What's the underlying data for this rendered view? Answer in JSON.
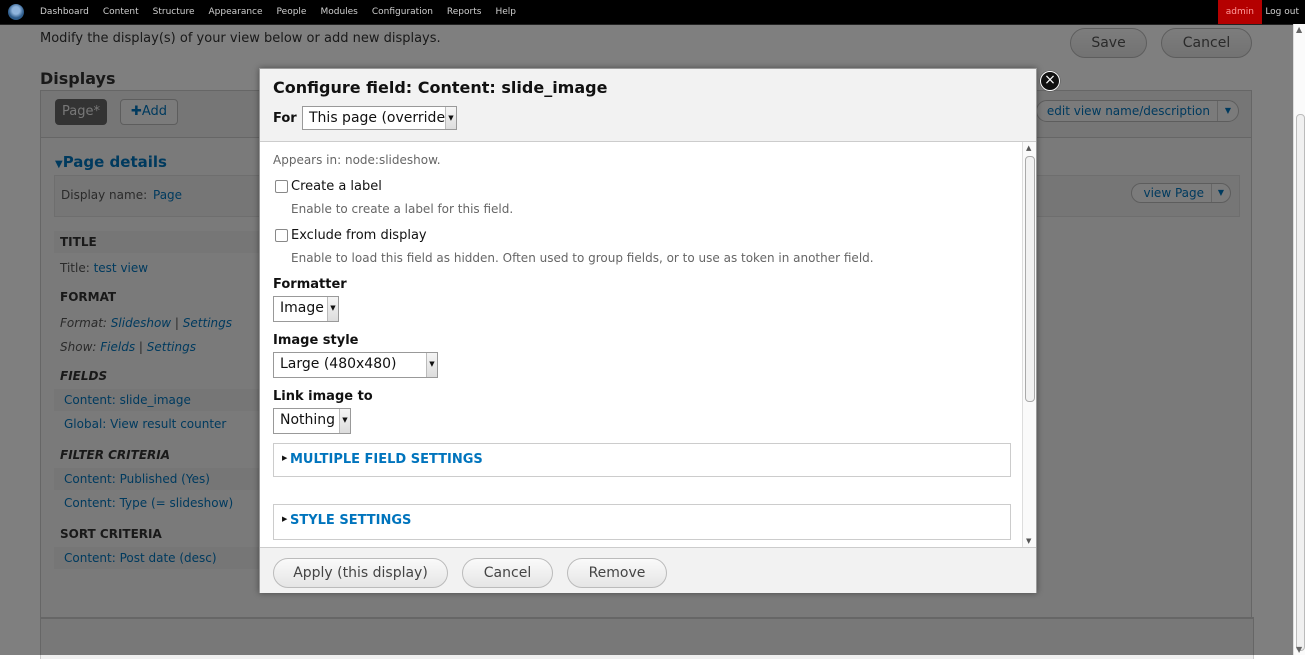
{
  "toolbar": {
    "menu": [
      "Dashboard",
      "Content",
      "Structure",
      "Appearance",
      "People",
      "Modules",
      "Configuration",
      "Reports",
      "Help"
    ],
    "user": "admin",
    "logout": "Log out"
  },
  "page": {
    "intro": "Modify the display(s) of your view below or add new displays.",
    "save": "Save",
    "cancel": "Cancel",
    "displays_heading": "Displays",
    "tab_page": "Page*",
    "tab_add": "Add",
    "edit_view": "edit view name/description",
    "page_details": "Page details",
    "display_name_label": "Display name:",
    "display_name_value": "Page",
    "view_page": "view Page",
    "sections": {
      "title_h": "TITLE",
      "title_label": "Title:",
      "title_value": "test view",
      "format_h": "FORMAT",
      "format_label": "Format:",
      "format_value": "Slideshow",
      "format_settings": "Settings",
      "show_label": "Show:",
      "show_value": "Fields",
      "show_settings": "Settings",
      "fields_h": "FIELDS",
      "fields": [
        "Content: slide_image",
        "Global: View result counter"
      ],
      "filter_h": "FILTER CRITERIA",
      "filters": [
        "Content: Published (Yes)",
        "Content: Type (= slideshow)"
      ],
      "sort_h": "SORT CRITERIA",
      "sorts": [
        "Content: Post date (desc)"
      ]
    }
  },
  "modal": {
    "title": "Configure field: Content: slide_image",
    "for_label": "For",
    "for_value": "This page (override)",
    "appears_in": "Appears in: node:slideshow.",
    "create_label": "Create a label",
    "create_label_desc": "Enable to create a label for this field.",
    "exclude": "Exclude from display",
    "exclude_desc": "Enable to load this field as hidden. Often used to group fields, or to use as token in another field.",
    "formatter_label": "Formatter",
    "formatter_value": "Image",
    "image_style_label": "Image style",
    "image_style_value": "Large (480x480)",
    "link_image_label": "Link image to",
    "link_image_value": "Nothing",
    "multiple_settings": "MULTIPLE FIELD SETTINGS",
    "style_settings": "STYLE SETTINGS",
    "apply": "Apply (this display)",
    "cancel": "Cancel",
    "remove": "Remove"
  }
}
